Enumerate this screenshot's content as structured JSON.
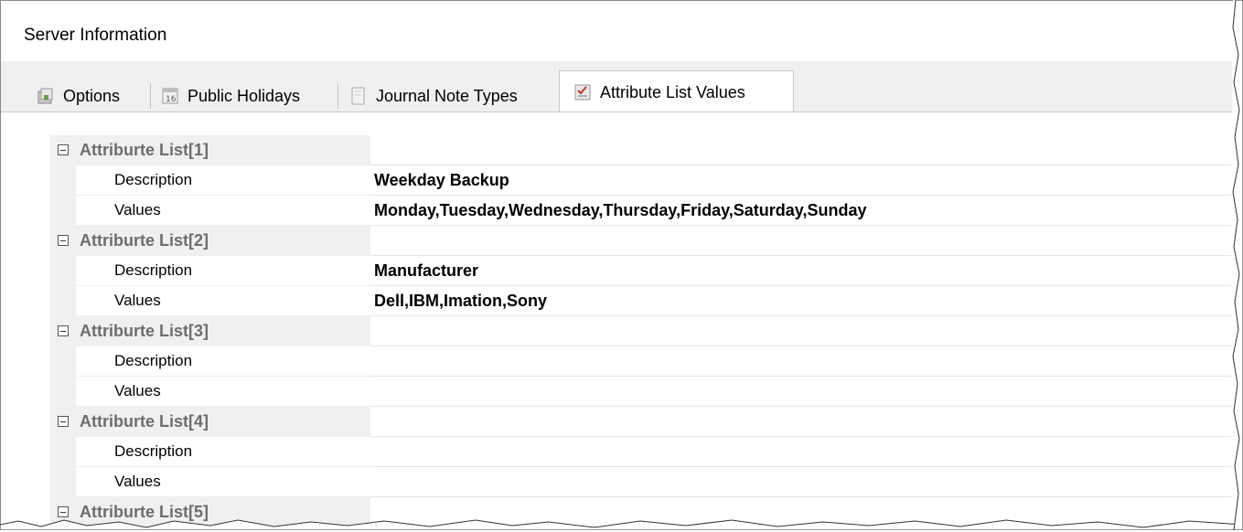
{
  "window": {
    "title": "Server Information"
  },
  "tabs": [
    {
      "label": "Options",
      "icon": "options-icon"
    },
    {
      "label": "Public Holidays",
      "icon": "calendar-icon"
    },
    {
      "label": "Journal Note Types",
      "icon": "journal-icon"
    },
    {
      "label": "Attribute List Values",
      "icon": "checklist-icon",
      "active": true
    }
  ],
  "grid": {
    "lists": [
      {
        "name": "Attriburte List[1]",
        "description_label": "Description",
        "description": "Weekday Backup",
        "values_label": "Values",
        "values": "Monday,Tuesday,Wednesday,Thursday,Friday,Saturday,Sunday"
      },
      {
        "name": "Attriburte List[2]",
        "description_label": "Description",
        "description": "Manufacturer",
        "values_label": "Values",
        "values": "Dell,IBM,Imation,Sony"
      },
      {
        "name": "Attriburte List[3]",
        "description_label": "Description",
        "description": "",
        "values_label": "Values",
        "values": ""
      },
      {
        "name": "Attriburte List[4]",
        "description_label": "Description",
        "description": "",
        "values_label": "Values",
        "values": ""
      },
      {
        "name": "Attriburte List[5]"
      }
    ]
  },
  "colors": {
    "tab_bg": "#f0f0f0",
    "category_text": "#6d6d6d",
    "grid_line": "#e6e6e6"
  }
}
